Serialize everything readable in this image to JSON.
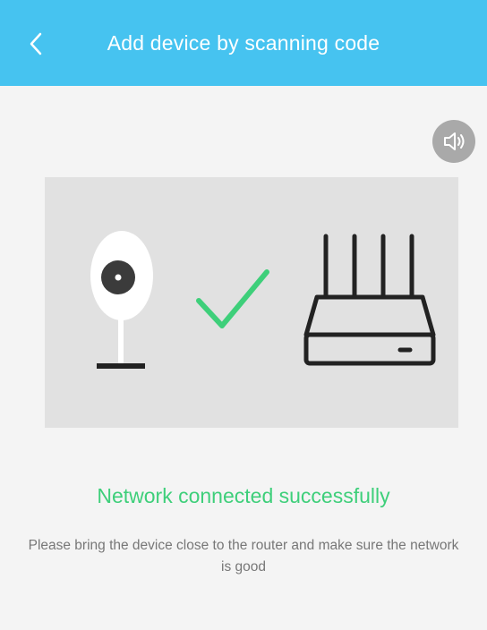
{
  "header": {
    "title": "Add device by scanning code",
    "back_icon": "chevron-left-icon",
    "background": "#46c3f0"
  },
  "sound_button": {
    "icon": "speaker-icon"
  },
  "illustration": {
    "camera_icon": "camera-icon",
    "check_icon": "checkmark-icon",
    "router_icon": "router-icon",
    "check_color": "#3ecf7a"
  },
  "status": {
    "message": "Network connected successfully",
    "hint": "Please bring the device close to the router and make sure the network is good",
    "color": "#3ecf7a"
  }
}
